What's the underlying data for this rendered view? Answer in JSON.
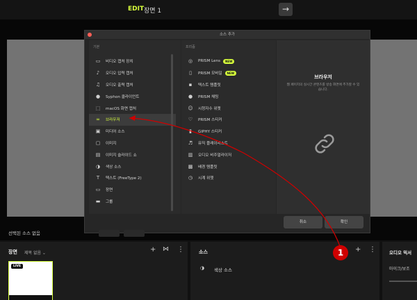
{
  "topbar": {
    "mode": "EDIT",
    "scene_title": "장면 1",
    "arrow": "→"
  },
  "modal": {
    "title": "소스 추가",
    "col1_header": "기본",
    "col2_header": "프리즘",
    "basic_items": [
      {
        "label": "비디오 캡처 장치",
        "icon": "camera-icon"
      },
      {
        "label": "오디오 입력 캡처",
        "icon": "microphone-icon"
      },
      {
        "label": "오디오 출력 캡처",
        "icon": "speaker-icon"
      },
      {
        "label": "Syphon 클라이언트",
        "icon": "syphon-icon"
      },
      {
        "label": "macOS 화면 캡처",
        "icon": "screen-capture-icon"
      },
      {
        "label": "브라우저",
        "icon": "link-icon",
        "selected": true
      },
      {
        "label": "미디어 소스",
        "icon": "media-icon"
      },
      {
        "label": "이미지",
        "icon": "image-icon"
      },
      {
        "label": "이미지 슬라이드 쇼",
        "icon": "slideshow-icon"
      },
      {
        "label": "색상 소스",
        "icon": "palette-icon"
      },
      {
        "label": "텍스트 (FreeType 2)",
        "icon": "text-icon"
      },
      {
        "label": "장면",
        "icon": "scene-icon"
      },
      {
        "label": "그룹",
        "icon": "folder-icon"
      }
    ],
    "prism_items": [
      {
        "label": "PRISM Lens",
        "icon": "lens-icon",
        "badge": "NEW"
      },
      {
        "label": "PRISM 모바일",
        "icon": "mobile-icon",
        "badge": "NEW"
      },
      {
        "label": "텍스트 템플릿",
        "icon": "text-template-icon"
      },
      {
        "label": "PRISM 채팅",
        "icon": "chat-icon"
      },
      {
        "label": "시청자수 위젯",
        "icon": "viewers-icon"
      },
      {
        "label": "PRISM 스티커",
        "icon": "sticker-icon"
      },
      {
        "label": "GIPHY 스티커",
        "icon": "giphy-icon"
      },
      {
        "label": "뮤직 플레이리스트",
        "icon": "music-icon"
      },
      {
        "label": "오디오 비주얼라이저",
        "icon": "visualizer-icon"
      },
      {
        "label": "배경 템플릿",
        "icon": "background-template-icon"
      },
      {
        "label": "시계 위젯",
        "icon": "clock-icon"
      }
    ],
    "preview_title": "브라우저",
    "preview_desc": "웹 페이지의 실시간 콘텐츠를 방송 화면에 추가할 수 있습니다.",
    "cancel_label": "취소",
    "ok_label": "확인"
  },
  "status": {
    "selected_none": "선택된 소스 없음"
  },
  "scenes_panel": {
    "title": "장면",
    "subtitle": "제목 없음 ⌄",
    "live_label": "LIVE"
  },
  "sources_panel": {
    "title": "소스",
    "item": "색상 소스"
  },
  "audio_panel": {
    "title": "오디오 믹서",
    "channel": "마이크/보조"
  },
  "annotation": {
    "step": "1"
  },
  "colors": {
    "accent": "#d8ff3c",
    "annotation_red": "#d00000"
  }
}
